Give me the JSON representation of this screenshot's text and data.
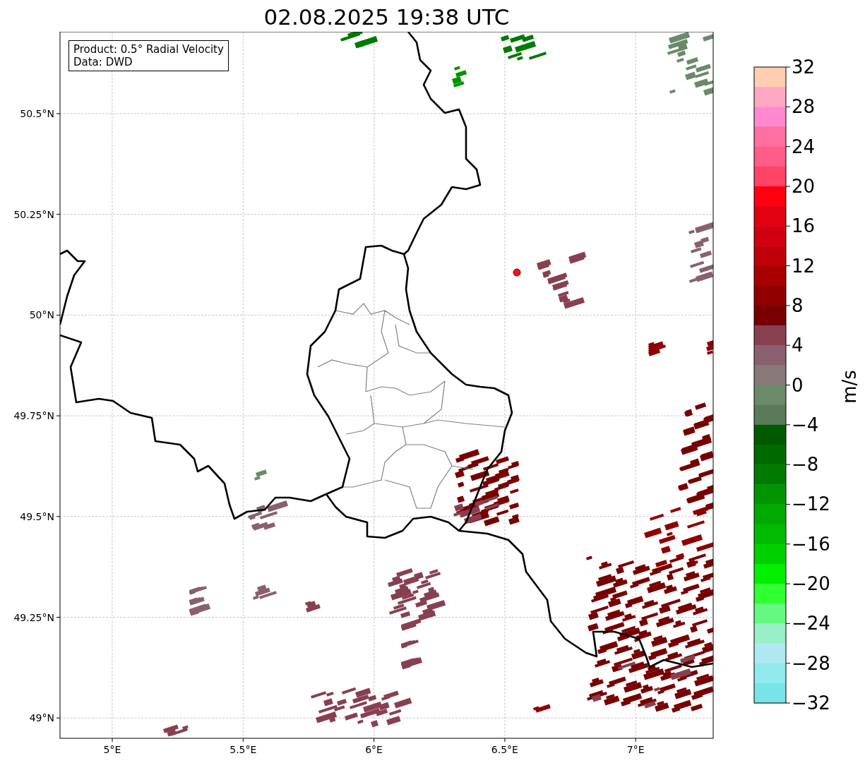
{
  "title": "02.08.2025 19:38 UTC",
  "info_box": {
    "lines": [
      "Product: 0.5° Radial Velocity",
      "Data: DWD"
    ]
  },
  "map": {
    "x_ticks": [
      "5°E",
      "5.5°E",
      "6°E",
      "6.5°E",
      "7°E"
    ],
    "y_ticks": [
      "50.5°N",
      "50.25°N",
      "50°N",
      "49.75°N",
      "49.5°N",
      "49.25°N",
      "49°N"
    ]
  },
  "colorbar": {
    "label": "m/s",
    "ticks": [
      "32",
      "28",
      "24",
      "20",
      "16",
      "12",
      "8",
      "4",
      "0",
      "−4",
      "−8",
      "−12",
      "−16",
      "−20",
      "−24",
      "−28",
      "−32"
    ],
    "bands": [
      {
        "color": "#ffcdb0"
      },
      {
        "color": "#ffa8c4"
      },
      {
        "color": "#ff88d0"
      },
      {
        "color": "#ff70a0"
      },
      {
        "color": "#ff5c88"
      },
      {
        "color": "#ff4468"
      },
      {
        "color": "#ff0010"
      },
      {
        "color": "#e00010"
      },
      {
        "color": "#d00010"
      },
      {
        "color": "#c00008"
      },
      {
        "color": "#a80000"
      },
      {
        "color": "#900000"
      },
      {
        "color": "#780000"
      },
      {
        "color": "#884050"
      },
      {
        "color": "#886070"
      },
      {
        "color": "#887878"
      },
      {
        "color": "#6a8a6a"
      },
      {
        "color": "#5a7a5a"
      },
      {
        "color": "#005a00"
      },
      {
        "color": "#006a00"
      },
      {
        "color": "#007a00"
      },
      {
        "color": "#009400"
      },
      {
        "color": "#00aa00"
      },
      {
        "color": "#00bb00"
      },
      {
        "color": "#00d000"
      },
      {
        "color": "#00f000"
      },
      {
        "color": "#30ff30"
      },
      {
        "color": "#66f880"
      },
      {
        "color": "#99f0c8"
      },
      {
        "color": "#b0e8f0"
      },
      {
        "color": "#90eaee"
      },
      {
        "color": "#78e4e8"
      }
    ]
  }
}
